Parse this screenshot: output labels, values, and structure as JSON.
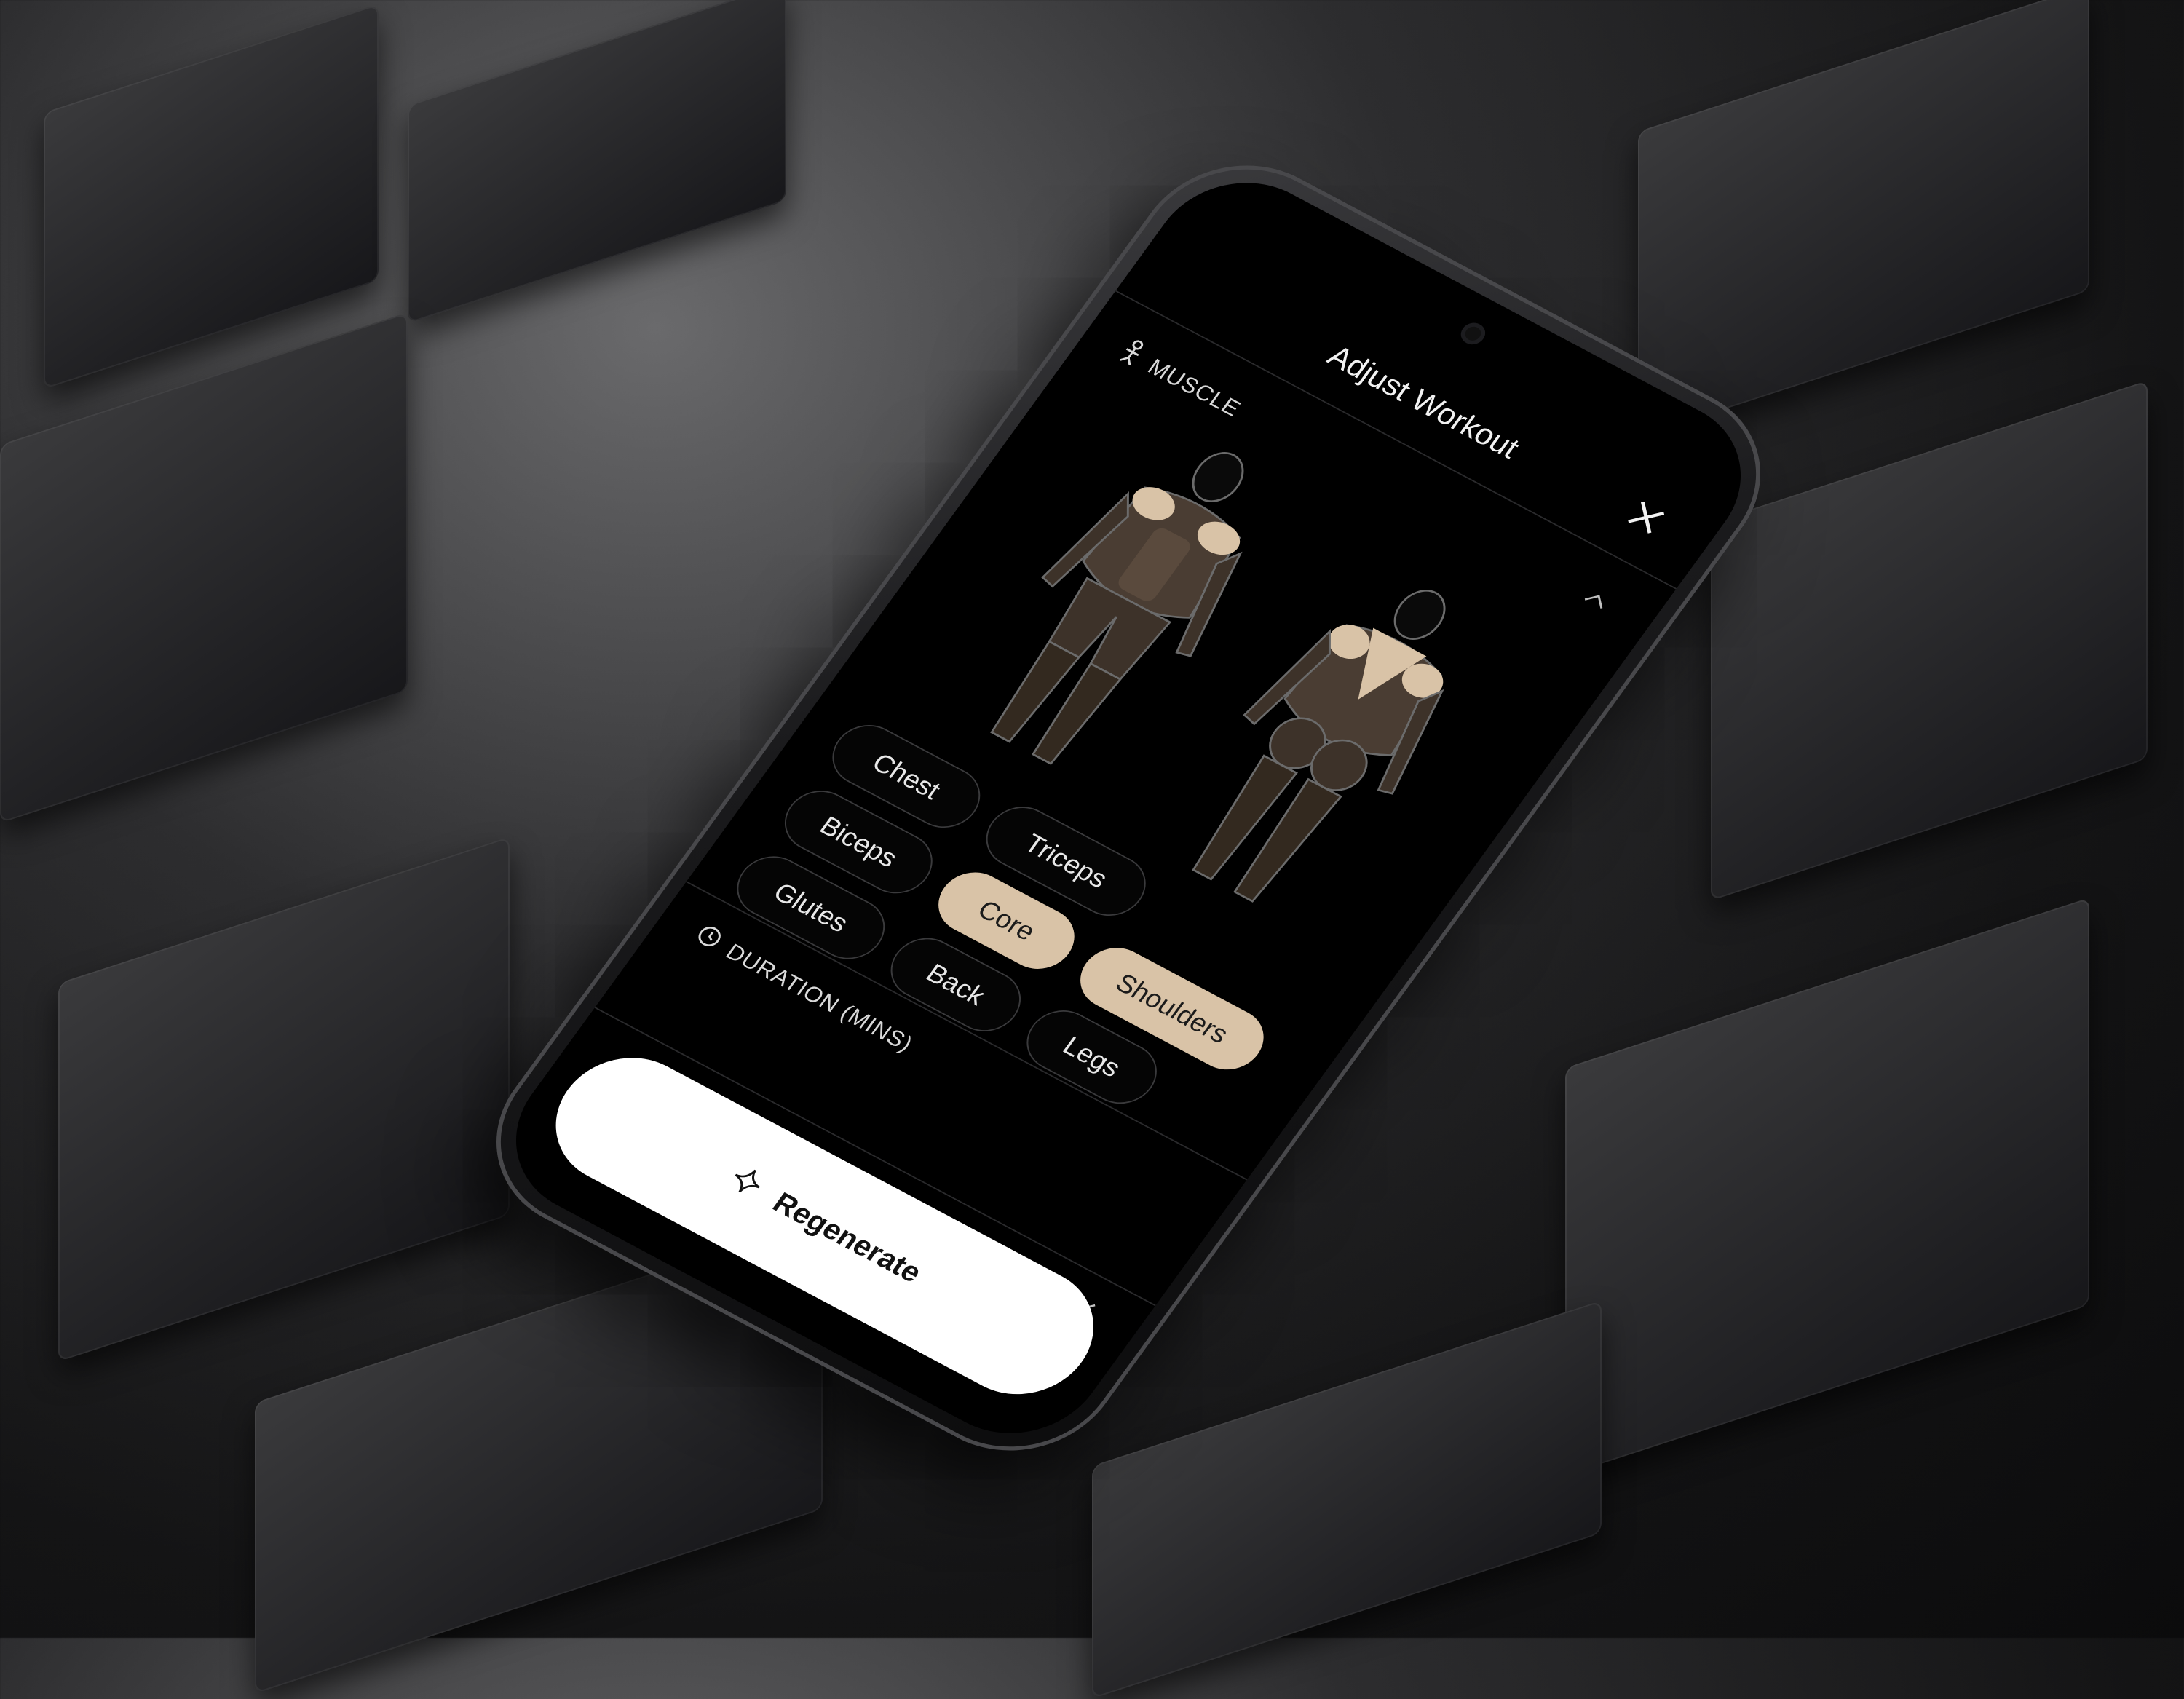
{
  "header": {
    "title": "Adjust Workout",
    "close_icon": "close-icon"
  },
  "muscle": {
    "label": "MUSCLE",
    "label_icon": "figure-icon",
    "toggle_icon": "chevron-up-icon",
    "chips": [
      {
        "label": "Chest",
        "selected": false
      },
      {
        "label": "Triceps",
        "selected": false
      },
      {
        "label": "Biceps",
        "selected": false
      },
      {
        "label": "Core",
        "selected": true
      },
      {
        "label": "Shoulders",
        "selected": true
      },
      {
        "label": "Glutes",
        "selected": false
      },
      {
        "label": "Back",
        "selected": false
      },
      {
        "label": "Legs",
        "selected": false
      }
    ]
  },
  "duration": {
    "label": "DURATION (MINS)",
    "label_icon": "clock-icon",
    "toggle_icon": "chevron-down-icon"
  },
  "cta": {
    "label": "Regenerate",
    "icon": "sparkle-icon"
  },
  "colors": {
    "accent": "#d9c3a7",
    "background": "#000000",
    "cta_bg": "#ffffff"
  }
}
